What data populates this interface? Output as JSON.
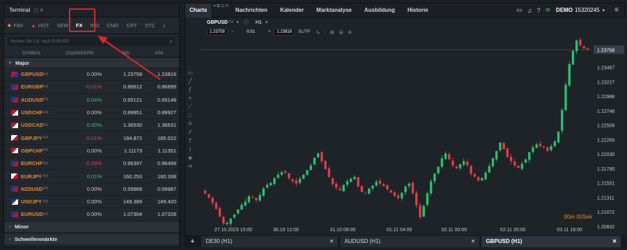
{
  "terminal": {
    "title": "Terminal",
    "window_icons": "▢ ✕",
    "categories": [
      {
        "label": "FAV",
        "icon": "star-icon"
      },
      {
        "label": "HOT",
        "icon": "flame-icon"
      },
      {
        "label": "SEM"
      },
      {
        "label": "FX"
      },
      {
        "label": "IND"
      },
      {
        "label": "CMD"
      },
      {
        "label": "CRT"
      },
      {
        "label": "STC"
      },
      {
        "label": "»"
      }
    ],
    "active_category": "FX",
    "search_placeholder": "Suchen Sie z.B. nach EURUSD",
    "columns": {
      "symbol": "SYMBOL",
      "change": "(1D)ÄNDERN",
      "bid": "BID",
      "ask": "ASK"
    },
    "groups": {
      "major": "Major",
      "minor": "Minor",
      "emerging": "Schwellenmärkte"
    },
    "rows": [
      {
        "symbol": "GBPUSD",
        "type": "FX",
        "change": "0.00%",
        "bid": "1.23758",
        "ask": "1.23816",
        "dir": "flat"
      },
      {
        "symbol": "EURGBP",
        "type": "FX",
        "change": "-0.01%",
        "bid": "0.86612",
        "ask": "0.86699",
        "dir": "down"
      },
      {
        "symbol": "AUDUSD",
        "type": "FX",
        "change": "0.04%",
        "bid": "0.65121",
        "ask": "0.65148",
        "dir": "up"
      },
      {
        "symbol": "USDCHF",
        "type": "FX",
        "change": "0.00%",
        "bid": "0.89851",
        "ask": "0.89927",
        "dir": "flat"
      },
      {
        "symbol": "USDCAD",
        "type": "FX",
        "change": "0.00%",
        "bid": "1.36530",
        "ask": "1.36631",
        "dir": "up"
      },
      {
        "symbol": "GBPJPY",
        "type": "FX",
        "change": "-0.01%",
        "bid": "184.872",
        "ask": "185.022",
        "dir": "down"
      },
      {
        "symbol": "GBPCHF",
        "type": "FX",
        "change": "0.00%",
        "bid": "1.11173",
        "ask": "1.11351",
        "dir": "flat"
      },
      {
        "symbol": "EURCHF",
        "type": "FX",
        "change": "-0.08%",
        "bid": "0.96397",
        "ask": "0.96499",
        "dir": "down"
      },
      {
        "symbol": "EURJPY",
        "type": "FX",
        "change": "0.01%",
        "bid": "160.253",
        "ask": "160.338",
        "dir": "up"
      },
      {
        "symbol": "NZDUSD",
        "type": "FX",
        "change": "0.00%",
        "bid": "0.59968",
        "ask": "0.59987",
        "dir": "flat"
      },
      {
        "symbol": "USDJPY",
        "type": "FX",
        "change": "0.00%",
        "bid": "149.389",
        "ask": "149.420",
        "dir": "flat"
      },
      {
        "symbol": "EURUSD",
        "type": "FX",
        "change": "0.00%",
        "bid": "1.07304",
        "ask": "1.07328",
        "dir": "flat"
      }
    ]
  },
  "charts": {
    "tabs": [
      "Charts",
      "Nachrichten",
      "Kalender",
      "Marktanalyse",
      "Ausbildung",
      "Historie"
    ],
    "account_label": "DEMO",
    "account_no": "15320245",
    "instrument": "GBPUSD",
    "instrument_type": "FX",
    "timeframe": "H1",
    "bid_box": "1.23758",
    "spread": "0.01",
    "ask_box": "1.23816",
    "sltp": "SL/TP",
    "timer": "00m 00Sek",
    "bottom_tabs": [
      "DE30 (H1)",
      "AUDUSD (H1)",
      "GBPUSD (H1)"
    ],
    "plus": "+",
    "tab_close": "✕"
  },
  "chart_data": {
    "type": "candlestick",
    "symbol": "GBPUSD",
    "timeframe": "H1",
    "y_ticks": [
      "1.23758",
      "1.23467",
      "1.23227",
      "1.22988",
      "1.22748",
      "1.22509",
      "1.22269",
      "1.22030",
      "1.21790",
      "1.21551",
      "1.21311",
      "1.21072",
      "1.20832"
    ],
    "ylim": [
      1.20832,
      1.23947
    ],
    "x_ticks": [
      "27.10.2023 15:00",
      "30.10 12:00",
      "31.10 08:00",
      "01.11 04:00",
      "02.11 00:00",
      "02.11 20:00",
      "03.11 16:00"
    ],
    "last_price": 1.23758,
    "close_trend": [
      1.2138,
      1.2131,
      1.2122,
      1.2112,
      1.2099,
      1.2088,
      1.2089,
      1.2096,
      1.2103,
      1.2111,
      1.2119,
      1.2124,
      1.2133,
      1.2131,
      1.2127,
      1.2135,
      1.2146,
      1.2152,
      1.2155,
      1.2163,
      1.2169,
      1.2173,
      1.2172,
      1.2163,
      1.2158,
      1.2154,
      1.2162,
      1.2169,
      1.2176,
      1.2184,
      1.2197,
      1.2204,
      1.2191,
      1.2178,
      1.2165,
      1.2153,
      1.2147,
      1.2143,
      1.2152,
      1.2158,
      1.2162,
      1.2165,
      1.2149,
      1.214,
      1.2138,
      1.2146,
      1.2151,
      1.2157,
      1.2154,
      1.215,
      1.2144,
      1.2139,
      1.2134,
      1.213,
      1.2139,
      1.2149,
      1.2154,
      1.2138,
      1.2118,
      1.2098,
      1.2117,
      1.2138,
      1.2158,
      1.217,
      1.2182,
      1.2196,
      1.2204,
      1.2194,
      1.2184,
      1.2179,
      1.2186,
      1.2191,
      1.2184,
      1.217,
      1.2165,
      1.2159,
      1.2163,
      1.2172,
      1.2183,
      1.2196,
      1.2208,
      1.2222,
      1.2211,
      1.2198,
      1.2191,
      1.2184,
      1.218,
      1.2187,
      1.2194,
      1.2206,
      1.2214,
      1.2219,
      1.2216,
      1.2214,
      1.2208,
      1.2216,
      1.2224,
      1.224,
      1.2276,
      1.2318,
      1.2352,
      1.2374,
      1.2391,
      1.2383,
      1.2378,
      1.2376
    ]
  }
}
